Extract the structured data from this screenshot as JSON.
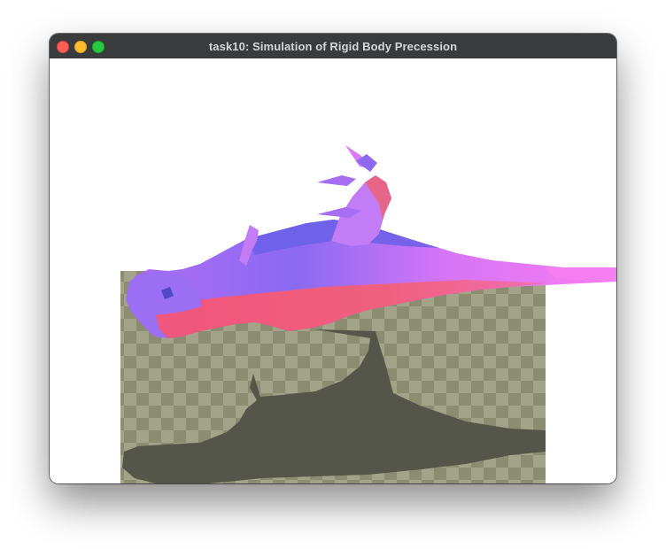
{
  "window": {
    "title": "task10: Simulation of Rigid Body Precession"
  },
  "scene": {
    "background_color": "#ffffff",
    "floor_light_color": "#a3a38a",
    "floor_dark_color": "#8c8c70",
    "shadow_color": "#55564a",
    "body_colors": [
      "#e978f7",
      "#a770f4",
      "#7466ee",
      "#f55a7a"
    ]
  }
}
